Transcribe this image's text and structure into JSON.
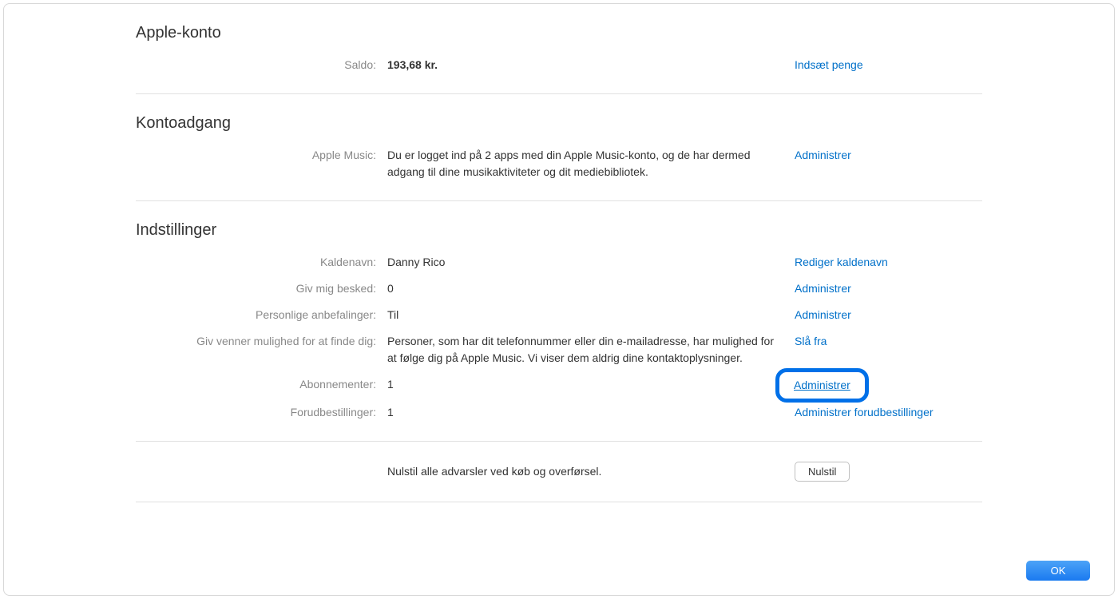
{
  "sections": {
    "apple_account": {
      "title": "Apple-konto",
      "balance_label": "Saldo:",
      "balance_value": "193,68 kr.",
      "add_funds": "Indsæt penge"
    },
    "account_access": {
      "title": "Kontoadgang",
      "apple_music_label": "Apple Music:",
      "apple_music_text": "Du er logget ind på 2 apps med din Apple Music-konto, og de har dermed adgang til dine musikaktiviteter og dit mediebibliotek.",
      "manage": "Administrer"
    },
    "settings": {
      "title": "Indstillinger",
      "nickname_label": "Kaldenavn:",
      "nickname_value": "Danny Rico",
      "edit_nickname": "Rediger kaldenavn",
      "notify_label": "Giv mig besked:",
      "notify_value": "0",
      "notify_manage": "Administrer",
      "recommendations_label": "Personlige anbefalinger:",
      "recommendations_value": "Til",
      "recommendations_manage": "Administrer",
      "friends_find_label": "Giv venner mulighed for at finde dig:",
      "friends_find_text": "Personer, som har dit telefonnummer eller din e-mailadresse, har mulighed for at følge dig på Apple Music. Vi viser dem aldrig dine kontaktoplysninger.",
      "turn_off": "Slå fra",
      "subscriptions_label": "Abonnementer:",
      "subscriptions_value": "1",
      "subscriptions_manage": "Administrer",
      "preorders_label": "Forudbestillinger:",
      "preorders_value": "1",
      "preorders_manage": "Administrer forudbestillinger"
    },
    "reset": {
      "text": "Nulstil alle advarsler ved køb og overførsel.",
      "button": "Nulstil"
    }
  },
  "footer": {
    "ok": "OK"
  }
}
